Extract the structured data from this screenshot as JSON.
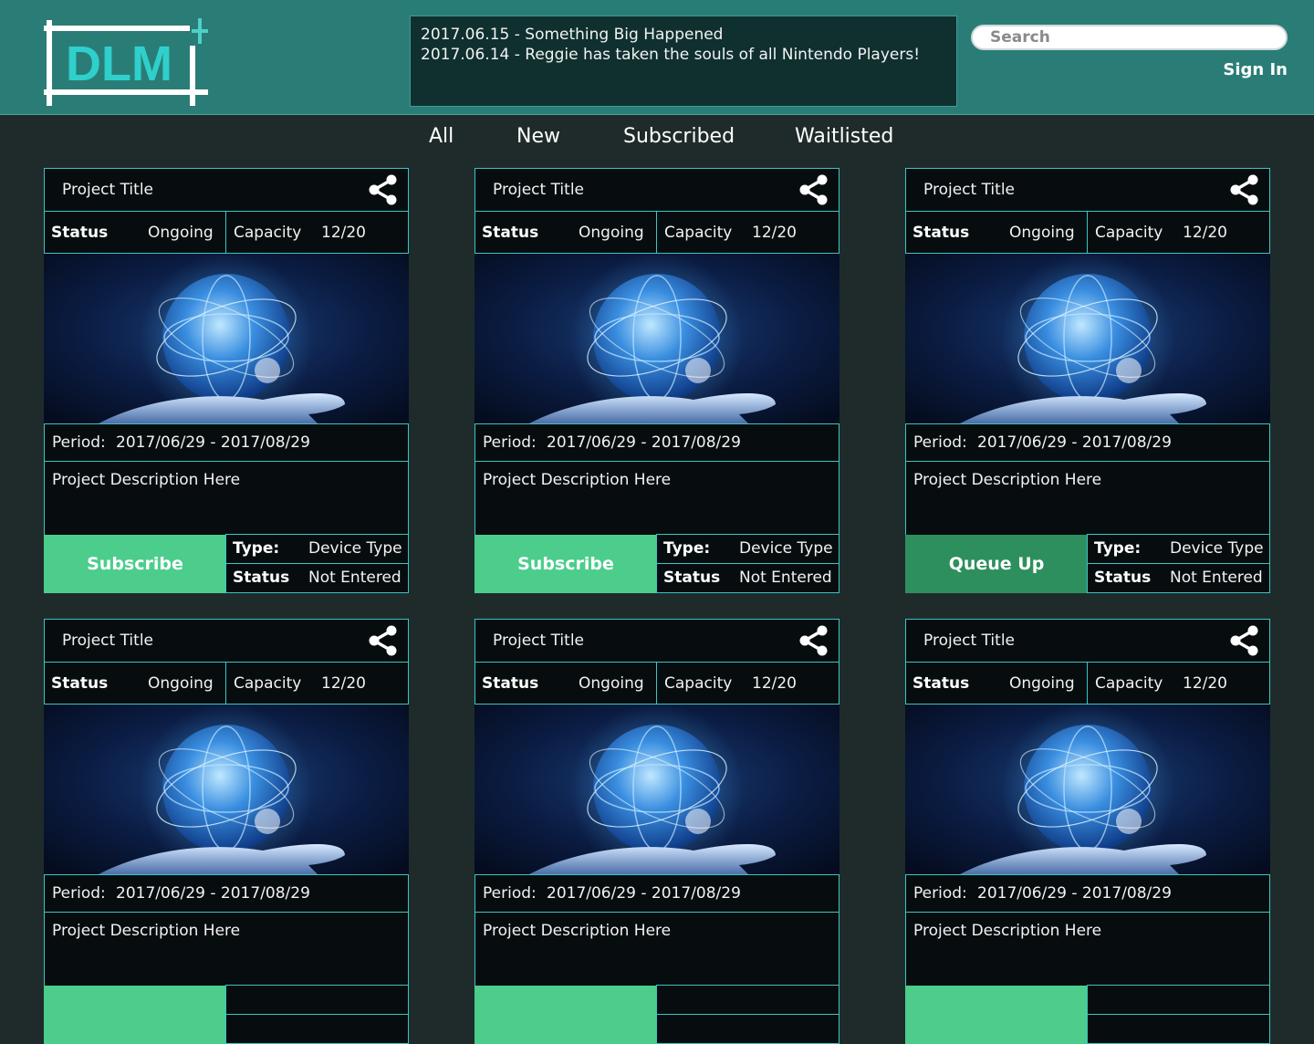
{
  "logo": {
    "text": "DLM"
  },
  "news": [
    "2017.06.15 - Something Big Happened",
    "2017.06.14 - Reggie has taken the souls of all Nintendo Players!"
  ],
  "search": {
    "placeholder": "Search"
  },
  "header": {
    "signin_label": "Sign In"
  },
  "tabs": [
    "All",
    "New",
    "Subscribed",
    "Waitlisted"
  ],
  "colors": {
    "header_bg": "#2a7d76",
    "page_bg": "#1f2b2b",
    "card_border": "#3bc4c4",
    "subscribe": "#4ccd8c",
    "queue": "#2e8f5e"
  },
  "cards": [
    {
      "title": "Project Title",
      "status_label": "Status",
      "status": "Ongoing",
      "capacity_label": "Capacity",
      "capacity": "12/20",
      "period_label": "Period:",
      "period": "2017/06/29 - 2017/08/29",
      "description": "Project Description Here",
      "action": "Subscribe",
      "type_label": "Type:",
      "type": "Device Type",
      "entry_label": "Status",
      "entry_status": "Not Entered"
    },
    {
      "title": "Project Title",
      "status_label": "Status",
      "status": "Ongoing",
      "capacity_label": "Capacity",
      "capacity": "12/20",
      "period_label": "Period:",
      "period": "2017/06/29 - 2017/08/29",
      "description": "Project Description Here",
      "action": "Subscribe",
      "type_label": "Type:",
      "type": "Device Type",
      "entry_label": "Status",
      "entry_status": "Not Entered"
    },
    {
      "title": "Project Title",
      "status_label": "Status",
      "status": "Ongoing",
      "capacity_label": "Capacity",
      "capacity": "12/20",
      "period_label": "Period:",
      "period": "2017/06/29 - 2017/08/29",
      "description": "Project Description Here",
      "action": "Queue Up",
      "type_label": "Type:",
      "type": "Device Type",
      "entry_label": "Status",
      "entry_status": "Not Entered"
    },
    {
      "title": "Project Title",
      "status_label": "Status",
      "status": "Ongoing",
      "capacity_label": "Capacity",
      "capacity": "12/20",
      "period_label": "Period:",
      "period": "2017/06/29 - 2017/08/29",
      "description": "Project Description Here"
    },
    {
      "title": "Project Title",
      "status_label": "Status",
      "status": "Ongoing",
      "capacity_label": "Capacity",
      "capacity": "12/20",
      "period_label": "Period:",
      "period": "2017/06/29 - 2017/08/29",
      "description": "Project Description Here"
    },
    {
      "title": "Project Title",
      "status_label": "Status",
      "status": "Ongoing",
      "capacity_label": "Capacity",
      "capacity": "12/20",
      "period_label": "Period:",
      "period": "2017/06/29 - 2017/08/29",
      "description": "Project Description Here"
    }
  ]
}
